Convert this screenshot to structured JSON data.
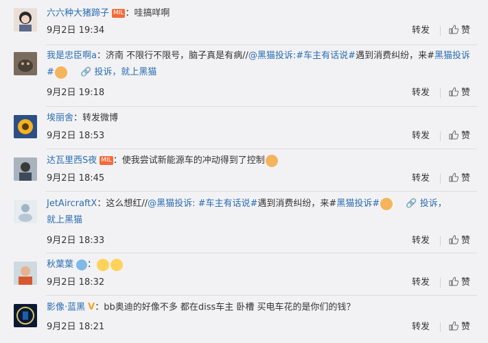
{
  "comments": [
    {
      "user": "六六种大猪蹄子",
      "text": "：哇搞咩啊",
      "time": "9月2日 19:34"
    },
    {
      "user": "我是忠臣啊a",
      "text_line1": "：济南 不限行不限号，脑子真是有病//",
      "link1": "@黑猫投诉",
      "tag1": ":#车主有话说#",
      "mid": "遇到消费纠纷，来#",
      "tag2": "黑猫投诉#",
      "link2": "投诉，就上黑猫",
      "time": "9月2日 19:18"
    },
    {
      "user": "埃丽舍",
      "text": "：转发微博",
      "time": "9月2日 18:53"
    },
    {
      "user": "达瓦里西S夜",
      "text": "：使我尝试新能源车的冲动得到了控制",
      "time": "9月2日 18:45"
    },
    {
      "user": "JetAircraftX",
      "text_line1": "：这么想红//",
      "link1": "@黑猫投诉",
      "tag1": ": #车主有话说#",
      "mid": "遇到消费纠纷，来#",
      "tag2": "黑猫投诉#",
      "link2a": "投诉，",
      "link2b": "就上黑猫",
      "time": "9月2日 18:33"
    },
    {
      "user": "秋葉葉",
      "text": "：",
      "time": "9月2日 18:32"
    },
    {
      "user": "影像·蓝黑",
      "text": "：bb奥迪的好像不多 都在diss车主 卧槽 买电车花的是你们的钱？",
      "time": "9月2日 18:21"
    }
  ],
  "actions": {
    "repost": "转发",
    "like": "赞"
  },
  "badge_text": "MIL",
  "v_mark": "V",
  "link_icon": "🔗"
}
